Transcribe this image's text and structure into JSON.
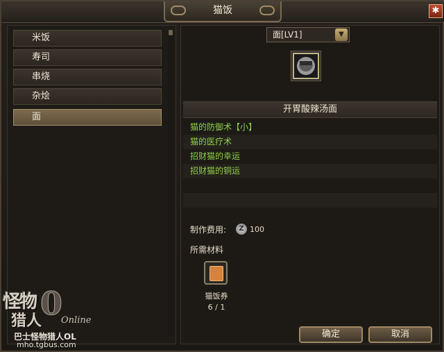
{
  "window": {
    "title": "猫饭"
  },
  "titlebar": {
    "close_icon": "close-icon",
    "close_glyph": "✱"
  },
  "categories": [
    {
      "label": "米饭"
    },
    {
      "label": "寿司"
    },
    {
      "label": "串烧"
    },
    {
      "label": "杂烩"
    },
    {
      "label": "面"
    }
  ],
  "selected_category": "面",
  "level_dropdown": {
    "value": "面[LV1]",
    "arrow": "▼"
  },
  "recipe": {
    "name": "开胃酸辣汤面",
    "effects": [
      "猫的防御术【小】",
      "猫的医疗术",
      "招财猫的幸运",
      "招财猫的铜运"
    ]
  },
  "cost": {
    "label": "制作费用:",
    "currency_glyph": "Z",
    "value": "100"
  },
  "materials": {
    "label": "所需材料",
    "items": [
      {
        "name": "猫饭券",
        "count": "6 / 1"
      }
    ]
  },
  "buttons": {
    "confirm": "确定",
    "cancel": "取消"
  },
  "logo": {
    "line1": "怪物",
    "line2": "猎人",
    "zero": "0",
    "online": "Online",
    "subtitle": "巴士怪物猎人OL",
    "url": "mho.tgbus.com"
  },
  "colors": {
    "effect_text": "#8fcf4e",
    "selected_item": "#6b5b43"
  }
}
